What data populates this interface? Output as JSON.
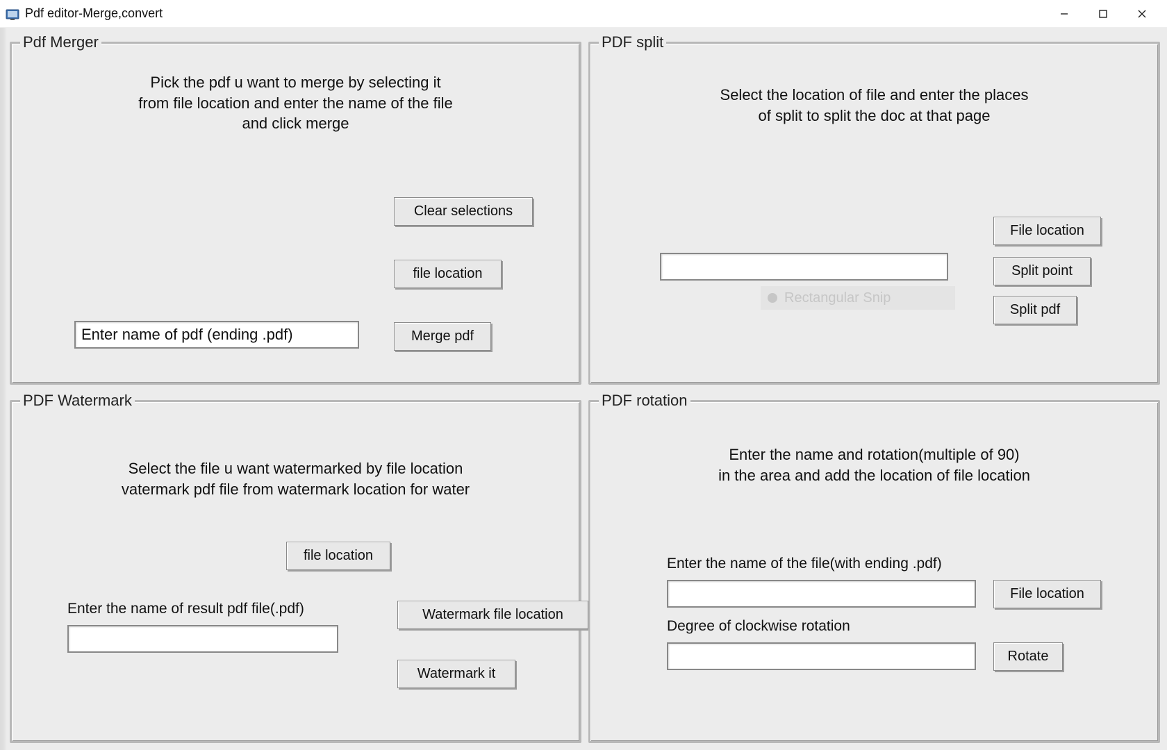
{
  "window": {
    "title": "Pdf editor-Merge,convert"
  },
  "merger": {
    "legend": "Pdf Merger",
    "desc": "Pick the pdf u want to merge by selecting it\nfrom file location and enter the name of the file\nand click merge",
    "clear_btn": "Clear selections",
    "file_btn": "file location",
    "merge_btn": "Merge pdf",
    "name_value": "Enter name of pdf (ending .pdf)"
  },
  "split": {
    "legend": "PDF split",
    "desc": "Select the location of file and enter the places\nof split to split the doc at that page",
    "file_btn": "File location",
    "point_btn": "Split point",
    "split_btn": "Split pdf",
    "input_value": "",
    "ghost": "Rectangular Snip"
  },
  "watermark": {
    "legend": "PDF Watermark",
    "desc": "Select the file u want watermarked by file location\nvatermark pdf file from watermark location for water",
    "file_btn": "file location",
    "wm_file_btn": "Watermark file location",
    "wm_btn": "Watermark it",
    "result_label": "Enter the name of result pdf file(.pdf)",
    "result_value": ""
  },
  "rotation": {
    "legend": "PDF rotation",
    "desc": "Enter the name and rotation(multiple of 90)\nin the area and add the location of file location",
    "name_label": "Enter the name of the file(with ending .pdf)",
    "name_value": "",
    "degree_label": "Degree of clockwise rotation",
    "degree_value": "",
    "file_btn": "File location",
    "rotate_btn": "Rotate"
  }
}
